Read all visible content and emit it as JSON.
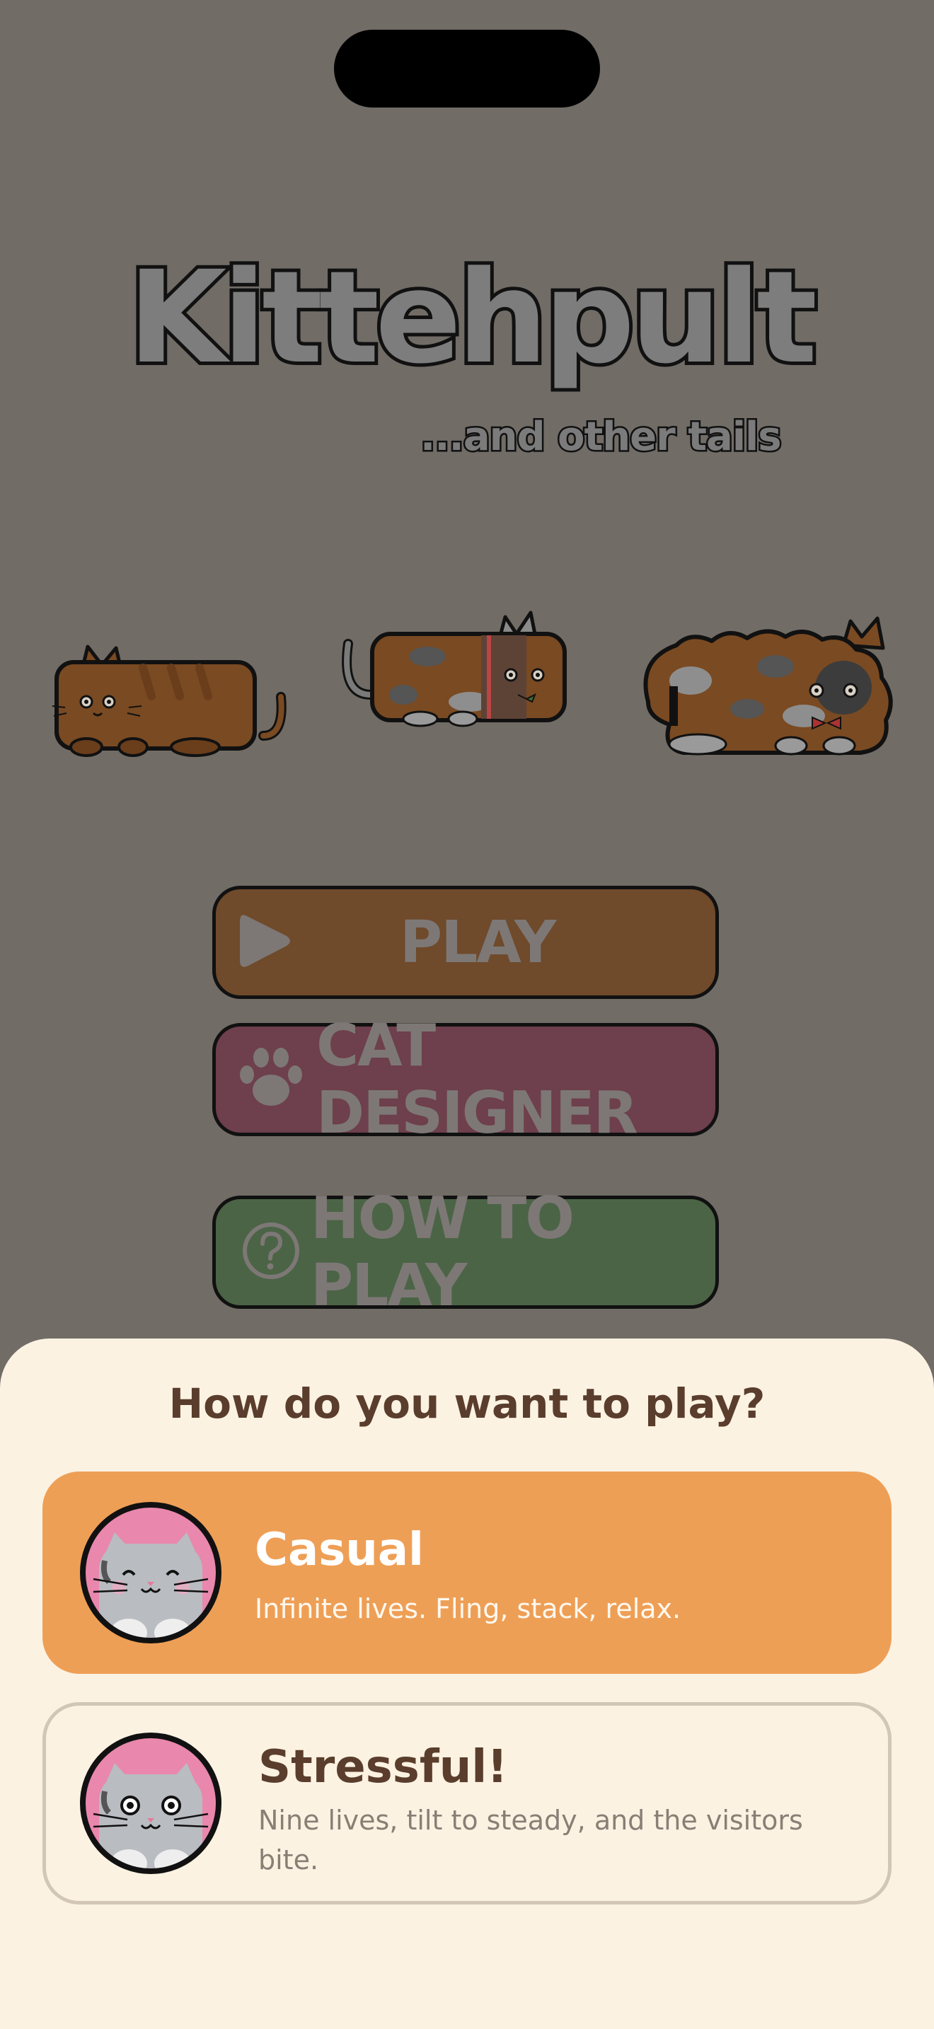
{
  "app": {
    "title": "Kittehpult",
    "subtitle": "...and other tails"
  },
  "menu": {
    "play_label": "PLAY",
    "designer_label": "CAT DESIGNER",
    "howto_label": "HOW TO PLAY"
  },
  "sheet": {
    "title": "How do you want to play?",
    "modes": [
      {
        "title": "Casual",
        "description": "Infinite lives. Fling, stack, relax.",
        "selected": true
      },
      {
        "title": "Stressful!",
        "description": "Nine lives, tilt to steady, and the visitors bite.",
        "selected": false
      }
    ]
  },
  "colors": {
    "backdrop": "#716c66",
    "sheet_bg": "#fcf2e2",
    "casual_accent": "#ee9f56",
    "play_btn": "#6f4a2b",
    "designer_btn": "#6e3f4c",
    "howto_btn": "#4b6446",
    "text_brown": "#5a3d2c"
  },
  "icons": [
    "play-icon",
    "paw-icon",
    "question-icon",
    "cat-avatar-icon"
  ]
}
